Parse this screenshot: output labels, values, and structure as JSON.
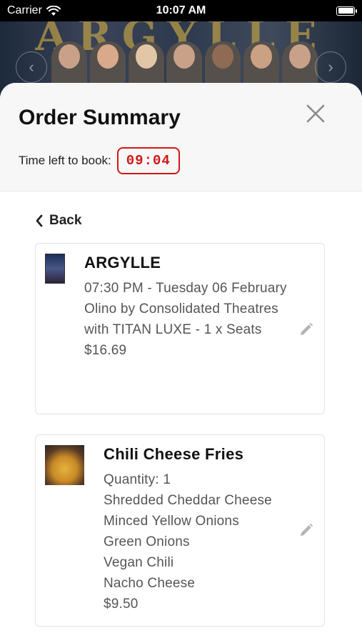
{
  "status_bar": {
    "carrier": "Carrier",
    "time": "10:07 AM"
  },
  "hero": {
    "title_text": "ARGYLLE"
  },
  "order": {
    "title": "Order Summary",
    "timer_label": "Time left to book:",
    "timer_value": "09:04",
    "back_label": "Back"
  },
  "ticket": {
    "title": "ARGYLLE",
    "lines": [
      "07:30 PM - Tuesday 06 February",
      "Olino by Consolidated Theatres with TITAN LUXE - 1 x Seats",
      "$16.69"
    ]
  },
  "food": {
    "title": "Chili Cheese Fries",
    "lines": [
      "Quantity: 1",
      "Shredded Cheddar Cheese",
      "Minced Yellow Onions",
      "Green Onions",
      "Vegan Chili",
      "Nacho Cheese",
      "$9.50"
    ]
  },
  "icons": {
    "close": "close-icon",
    "back": "chevron-left-icon",
    "edit": "pencil-icon",
    "wifi": "wifi-icon",
    "battery": "battery-icon"
  },
  "colors": {
    "timer": "#d01818",
    "sheet_header": "#f7f7f7"
  }
}
